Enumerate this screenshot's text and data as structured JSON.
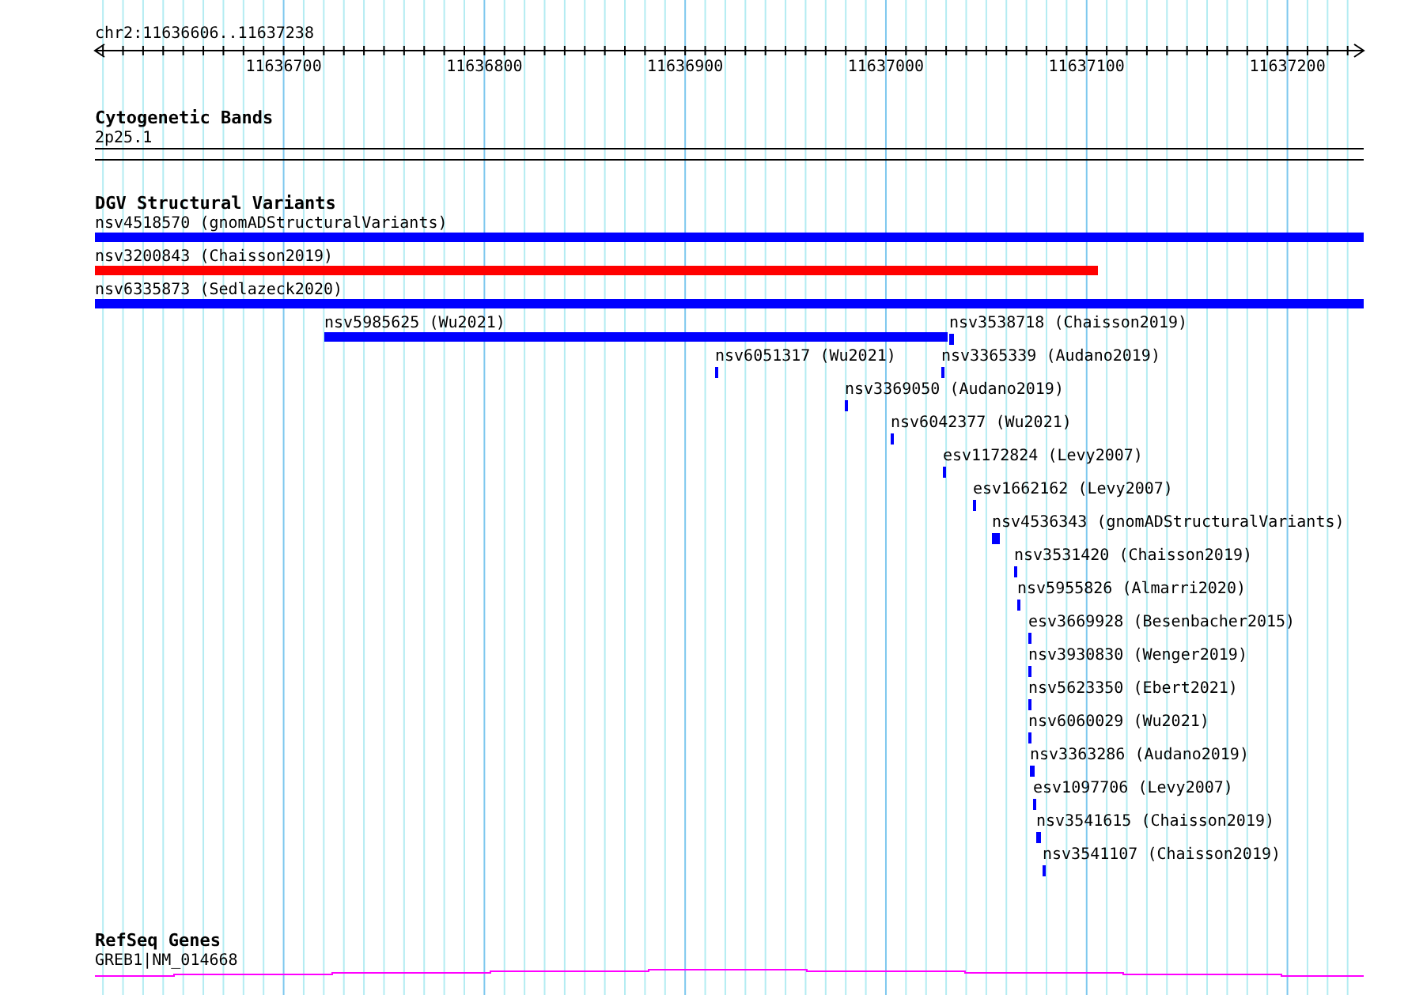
{
  "ruler": {
    "location": "chr2:11636606..11637238",
    "ticks": [
      {
        "label": "11636700"
      },
      {
        "label": "11636800"
      },
      {
        "label": "11636900"
      },
      {
        "label": "11637000"
      },
      {
        "label": "11637100"
      },
      {
        "label": "11637200"
      }
    ]
  },
  "tracks": [
    {
      "kind": "bands",
      "title": "Cytogenetic Bands",
      "label": "2p25.1"
    },
    {
      "kind": "variants",
      "title": "DGV Structural Variants",
      "rows": [
        [
          {
            "label": "nsv4518570 (gnomADStructuralVariants)",
            "color": "#0000ff"
          }
        ],
        [
          {
            "label": "nsv3200843 (Chaisson2019)",
            "color": "#ff0000"
          }
        ],
        [
          {
            "label": "nsv6335873 (Sedlazeck2020)",
            "color": "#0000ff"
          }
        ],
        [
          {
            "label": "nsv5985625 (Wu2021)",
            "color": "#0000ff"
          },
          {
            "label": "nsv3538718 (Chaisson2019)",
            "color": "#0000ff"
          }
        ],
        [
          {
            "label": "nsv6051317 (Wu2021)",
            "color": "#0000ff"
          },
          {
            "label": "nsv3365339 (Audano2019)",
            "color": "#0000ff"
          }
        ],
        [
          {
            "label": "nsv3369050 (Audano2019)",
            "color": "#0000ff"
          }
        ],
        [
          {
            "label": "nsv6042377 (Wu2021)",
            "color": "#0000ff"
          }
        ],
        [
          {
            "label": "esv1172824 (Levy2007)",
            "color": "#0000ff"
          }
        ],
        [
          {
            "label": "esv1662162 (Levy2007)",
            "color": "#0000ff"
          }
        ],
        [
          {
            "label": "nsv4536343 (gnomADStructuralVariants)",
            "color": "#0000ff"
          }
        ],
        [
          {
            "label": "nsv3531420 (Chaisson2019)",
            "color": "#0000ff"
          }
        ],
        [
          {
            "label": "nsv5955826 (Almarri2020)",
            "color": "#0000ff"
          }
        ],
        [
          {
            "label": "esv3669928 (Besenbacher2015)",
            "color": "#0000ff"
          }
        ],
        [
          {
            "label": "nsv3930830 (Wenger2019)",
            "color": "#0000ff"
          }
        ],
        [
          {
            "label": "nsv5623350 (Ebert2021)",
            "color": "#0000ff"
          }
        ],
        [
          {
            "label": "nsv6060029 (Wu2021)",
            "color": "#0000ff"
          }
        ],
        [
          {
            "label": "nsv3363286 (Audano2019)",
            "color": "#0000ff"
          }
        ],
        [
          {
            "label": "esv1097706 (Levy2007)",
            "color": "#0000ff"
          }
        ],
        [
          {
            "label": "nsv3541615 (Chaisson2019)",
            "color": "#0000ff"
          }
        ],
        [
          {
            "label": "nsv3541107 (Chaisson2019)",
            "color": "#0000ff"
          }
        ]
      ]
    },
    {
      "kind": "genes",
      "title": "RefSeq Genes",
      "label": "GREB1|NM_014668"
    }
  ]
}
